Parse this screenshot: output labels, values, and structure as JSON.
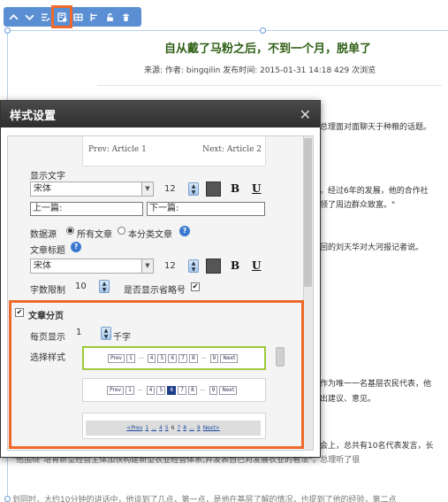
{
  "toolbar": {
    "buttons": [
      {
        "name": "move-up-icon",
        "glyph": "▲"
      },
      {
        "name": "move-down-icon",
        "glyph": "▼"
      },
      {
        "name": "edit-icon",
        "glyph": "✎"
      },
      {
        "name": "style-settings-icon",
        "glyph": "⚙"
      },
      {
        "name": "grid-icon",
        "glyph": "▦"
      },
      {
        "name": "align-icon",
        "glyph": "▥"
      },
      {
        "name": "unlock-icon",
        "glyph": "🔓"
      },
      {
        "name": "delete-icon",
        "glyph": "🗑"
      }
    ],
    "accent": "#5a8fd4"
  },
  "article": {
    "title": "自从戴了马粉之后，不到一个月，脱单了",
    "meta": "来源:   作者: bingqilin  发布时间: 2015-01-31 14:18  429 次浏览",
    "lines": [
      "总理面对面聊天于种粮的话题。",
      "。经过6年的发展，他的合作社",
      "领了周边群众致富。\"",
      "回的刘天华对大河报记者说。",
      "作为唯一一名基层农民代表，他",
      "出建议、意见。",
      "会上，总共有10名代表发言，长",
      "\"他围绕\"培育新型经营主体加快构建新型农业经营体系,并发表自己对发展农业的看法\"，总理听了很",
      "划同时，大约10分钟的讲话中，他谈到了几点，第一点，是他在基层了解的情况，也提到了他的经验，第二点"
    ]
  },
  "dialog": {
    "title": "样式设置",
    "close_glyph": "✕",
    "preview": {
      "prev": "Prev: Article 1",
      "next": "Next: Article 2"
    },
    "display_text": {
      "label": "显示文字",
      "font": "宋体",
      "size": "12",
      "bold": "B",
      "underline": "U",
      "prev_text": "上一篇:",
      "next_text": "下一篇:"
    },
    "data_source": {
      "label": "数据源",
      "options": [
        "所有文章",
        "本分类文章"
      ],
      "selected": "所有文章"
    },
    "article_title": {
      "label": "文章标题",
      "font": "宋体",
      "size": "12",
      "bold": "B",
      "underline": "U"
    },
    "char_limit": {
      "label": "字数限制",
      "value": "10",
      "ellipsis_label": "是否显示省略号",
      "ellipsis_checked": true
    },
    "pagination": {
      "label": "文章分页",
      "checked": true,
      "per_page_label": "每页显示",
      "per_page_value": "1",
      "per_page_unit": "千字",
      "style_label": "选择样式",
      "style1": [
        "Prev",
        "1",
        "...",
        "4",
        "5",
        "6",
        "7",
        "8",
        "...",
        "9",
        "Next"
      ],
      "style2": [
        "Prev",
        "1",
        "...",
        "4",
        "5",
        "6",
        "7",
        "8",
        "...",
        "9",
        "Next"
      ],
      "style3": [
        "<Prev",
        "1",
        "...",
        "4",
        "5",
        "6",
        "7",
        "8",
        "...",
        "9",
        "Next>"
      ],
      "current_page": "6",
      "highlight": "#ee6a2a",
      "selected_border": "#9dc93b"
    }
  }
}
